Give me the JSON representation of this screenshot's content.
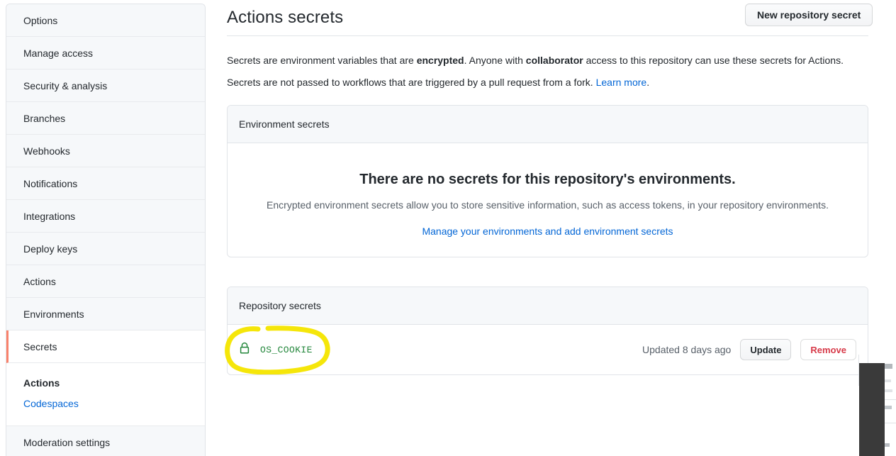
{
  "sidebar": {
    "items": [
      {
        "label": "Options",
        "active": false
      },
      {
        "label": "Manage access",
        "active": false
      },
      {
        "label": "Security & analysis",
        "active": false
      },
      {
        "label": "Branches",
        "active": false
      },
      {
        "label": "Webhooks",
        "active": false
      },
      {
        "label": "Notifications",
        "active": false
      },
      {
        "label": "Integrations",
        "active": false
      },
      {
        "label": "Deploy keys",
        "active": false
      },
      {
        "label": "Actions",
        "active": false
      },
      {
        "label": "Environments",
        "active": false
      },
      {
        "label": "Secrets",
        "active": true
      }
    ],
    "subitems": [
      {
        "label": "Actions",
        "current": true
      },
      {
        "label": "Codespaces",
        "current": false
      }
    ],
    "trailing_items": [
      {
        "label": "Moderation settings",
        "active": false
      }
    ],
    "active_accent_color": "#f9826c",
    "link_color": "#0366d6"
  },
  "main": {
    "title": "Actions secrets",
    "new_secret_button": "New repository secret",
    "description_1": {
      "part_1": "Secrets are environment variables that are ",
      "bold_1": "encrypted",
      "part_2": ". Anyone with ",
      "bold_2": "collaborator",
      "part_3": " access to this repository can use these secrets for Actions."
    },
    "description_2": {
      "part_1": "Secrets are not passed to workflows that are triggered by a pull request from a fork. ",
      "link": "Learn more",
      "part_2": "."
    },
    "environment_secrets": {
      "header": "Environment secrets",
      "empty_title": "There are no secrets for this repository's environments.",
      "empty_subtitle": "Encrypted environment secrets allow you to store sensitive information, such as access tokens, in your repository environments.",
      "empty_link": "Manage your environments and add environment secrets"
    },
    "repository_secrets": {
      "header": "Repository secrets",
      "rows": [
        {
          "icon": "lock-icon",
          "name": "OS_COOKIE",
          "updated": "Updated 8 days ago",
          "update_button": "Update",
          "remove_button": "Remove",
          "name_color": "#22863a",
          "highlighted": true
        }
      ]
    }
  },
  "annotation": {
    "type": "hand-drawn-ellipse",
    "color": "#f5e60a",
    "targets": "OS_COOKIE"
  }
}
